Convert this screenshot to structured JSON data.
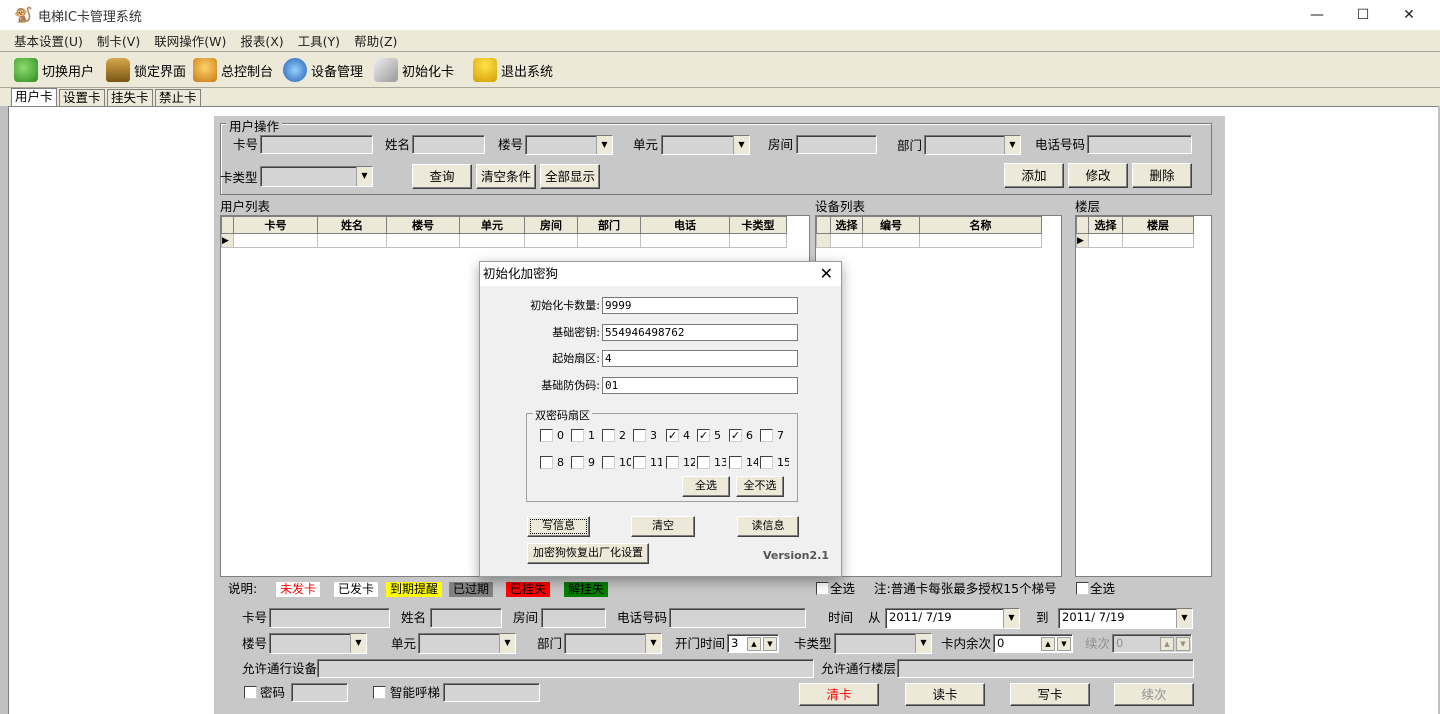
{
  "window": {
    "title": "电梯IC卡管理系统",
    "minimize": "—",
    "maximize": "☐",
    "close": "✕"
  },
  "menu": [
    "基本设置(U)",
    "制卡(V)",
    "联网操作(W)",
    "报表(X)",
    "工具(Y)",
    "帮助(Z)"
  ],
  "toolbar": [
    "切换用户",
    "锁定界面",
    "总控制台",
    "设备管理",
    "初始化卡",
    "退出系统"
  ],
  "tabs": [
    "用户卡",
    "设置卡",
    "挂失卡",
    "禁止卡"
  ],
  "user_ops": {
    "title": "用户操作",
    "card_no": "卡号",
    "name": "姓名",
    "building": "楼号",
    "unit": "单元",
    "room": "房间",
    "dept": "部门",
    "phone": "电话号码",
    "card_type": "卡类型",
    "query": "查询",
    "clear": "清空条件",
    "show_all": "全部显示",
    "add": "添加",
    "edit": "修改",
    "delete": "删除"
  },
  "user_list": {
    "title": "用户列表",
    "columns": [
      "卡号",
      "姓名",
      "楼号",
      "单元",
      "房间",
      "部门",
      "电话",
      "卡类型"
    ]
  },
  "device_list": {
    "title": "设备列表",
    "columns": [
      "选择",
      "编号",
      "名称"
    ]
  },
  "floor_list": {
    "title": "楼层",
    "columns": [
      "选择",
      "楼层"
    ]
  },
  "legend": {
    "label": "说明:",
    "items": [
      {
        "text": "未发卡",
        "bg": "#ffffff",
        "fg": "#ff0000"
      },
      {
        "text": "已发卡",
        "bg": "#ffffff",
        "fg": "#000000"
      },
      {
        "text": "到期提醒",
        "bg": "#ffff00",
        "fg": "#000000"
      },
      {
        "text": "已过期",
        "bg": "#808080",
        "fg": "#000000"
      },
      {
        "text": "已挂失",
        "bg": "#ff0000",
        "fg": "#000000"
      },
      {
        "text": "解挂失",
        "bg": "#008000",
        "fg": "#000000"
      }
    ],
    "select_all_1": "全选",
    "note": "注:普通卡每张最多授权15个梯号",
    "select_all_2": "全选"
  },
  "form": {
    "card_no": "卡号",
    "name": "姓名",
    "room": "房间",
    "phone": "电话号码",
    "time": "时间",
    "from": "从",
    "from_date": "2011/ 7/19",
    "to": "到",
    "to_date": "2011/ 7/19",
    "building": "楼号",
    "unit": "单元",
    "dept": "部门",
    "open_time": "开门时间",
    "open_time_val": "3",
    "card_type": "卡类型",
    "remaining": "卡内余次",
    "remaining_val": "0",
    "renew": "续次",
    "renew_val": "0",
    "allowed_devices": "允许通行设备",
    "allowed_floors": "允许通行楼层",
    "password": "密码",
    "smart_call": "智能呼梯",
    "clear_card": "清卡",
    "read_card": "读卡",
    "write_card": "写卡",
    "renew_btn": "续次"
  },
  "dialog": {
    "title": "初始化加密狗",
    "count_label": "初始化卡数量:",
    "count": "9999",
    "key_label": "基础密钥:",
    "key": "554946498762",
    "sector_label": "起始扇区:",
    "sector": "4",
    "anti_label": "基础防伪码:",
    "anti": "01",
    "dual_label": "双密码扇区",
    "sectors": [
      {
        "n": "0",
        "c": false
      },
      {
        "n": "1",
        "c": false
      },
      {
        "n": "2",
        "c": false
      },
      {
        "n": "3",
        "c": false
      },
      {
        "n": "4",
        "c": true
      },
      {
        "n": "5",
        "c": true
      },
      {
        "n": "6",
        "c": true
      },
      {
        "n": "7",
        "c": false
      },
      {
        "n": "8",
        "c": false
      },
      {
        "n": "9",
        "c": false
      },
      {
        "n": "10",
        "c": false
      },
      {
        "n": "11",
        "c": false
      },
      {
        "n": "12",
        "c": false
      },
      {
        "n": "13",
        "c": false
      },
      {
        "n": "14",
        "c": false
      },
      {
        "n": "15",
        "c": false
      }
    ],
    "select_all": "全选",
    "select_none": "全不选",
    "write": "写信息",
    "clear": "清空",
    "read": "读信息",
    "factory": "加密狗恢复出厂化设置",
    "version": "Version2.1",
    "close": "✕"
  }
}
